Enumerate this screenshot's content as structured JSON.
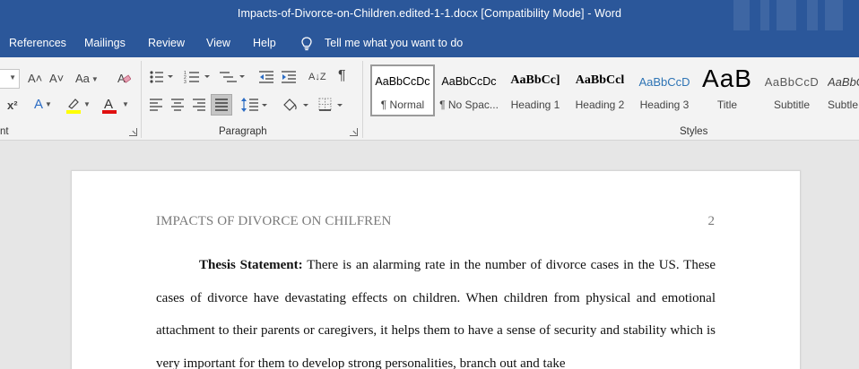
{
  "window": {
    "title": "Impacts-of-Divorce-on-Children.edited-1-1.docx  [Compatibility Mode]  -  Word"
  },
  "menu": {
    "tabs": [
      "References",
      "Mailings",
      "Review",
      "View",
      "Help"
    ],
    "tell_me": "Tell me what you want to do"
  },
  "ribbon": {
    "groups": {
      "font_label": "nt",
      "paragraph_label": "Paragraph",
      "styles_label": "Styles"
    },
    "font": {
      "grow_icon": "A˄",
      "shrink_icon": "A˅",
      "change_case_icon": "Aa",
      "superscript_icon": "x²",
      "text_effects_icon": "A",
      "font_color_icon": "A"
    },
    "paragraph": {
      "sort_icon": "A↓Z",
      "pilcrow_icon": "¶"
    },
    "styles": [
      {
        "sample": "AaBbCcDc",
        "name": "¶ Normal",
        "selected": true
      },
      {
        "sample": "AaBbCcDc",
        "name": "¶ No Spac..."
      },
      {
        "sample": "AaBbCc]",
        "name": "Heading 1"
      },
      {
        "sample": "AaBbCcl",
        "name": "Heading 2"
      },
      {
        "sample": "AaBbCcD",
        "name": "Heading 3"
      },
      {
        "sample": "AaB",
        "name": "Title"
      },
      {
        "sample": "AaBbCcD",
        "name": "Subtitle"
      },
      {
        "sample": "AaBbC",
        "name": "Subtle"
      }
    ]
  },
  "document": {
    "running_head": "IMPACTS OF DIVORCE ON CHILFREN",
    "page_number": "2",
    "paragraph_label": "Thesis Statement:",
    "paragraph_text": " There is an alarming rate in the number of divorce cases in the US. These cases of divorce have devastating effects on children. When children from physical and emotional attachment to their parents or caregivers, it helps them to have a sense of security and stability which is very important for them to develop strong personalities, branch out and take"
  },
  "colors": {
    "title_bar": "#2b579a",
    "ribbon_bg": "#f3f3f3",
    "workspace_bg": "#e6e6e6",
    "highlight_yellow": "#ffff00",
    "font_color_red": "#e01010",
    "heading3_blue": "#2e74b5"
  }
}
